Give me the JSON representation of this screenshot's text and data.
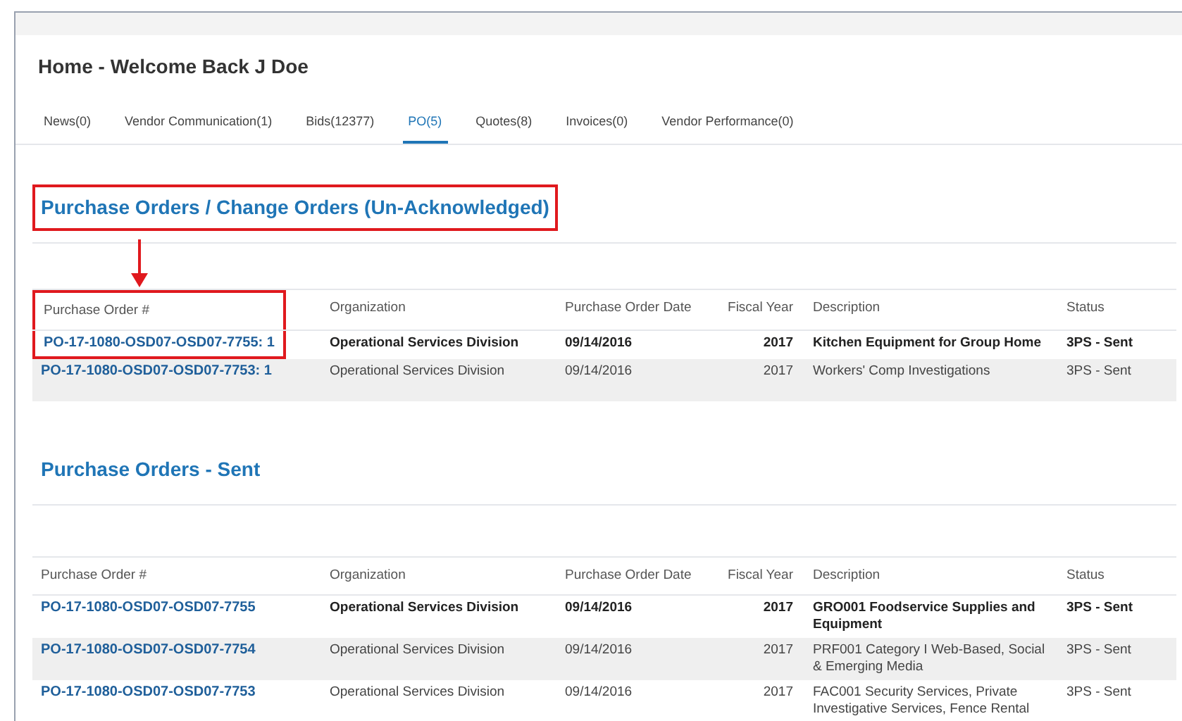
{
  "page_title": "Home - Welcome Back J Doe",
  "tabs": [
    {
      "label": "News(0)",
      "selected": false
    },
    {
      "label": "Vendor Communication(1)",
      "selected": false
    },
    {
      "label": "Bids(12377)",
      "selected": false
    },
    {
      "label": "PO(5)",
      "selected": true
    },
    {
      "label": "Quotes(8)",
      "selected": false
    },
    {
      "label": "Invoices(0)",
      "selected": false
    },
    {
      "label": "Vendor Performance(0)",
      "selected": false
    }
  ],
  "sections": [
    {
      "title": "Purchase Orders / Change Orders (Un-Acknowledged)",
      "callout": true,
      "columns": [
        "Purchase Order #",
        "Organization",
        "Purchase Order Date",
        "Fiscal Year",
        "Description",
        "Status"
      ],
      "rows": [
        {
          "bold": true,
          "cells": [
            "PO-17-1080-OSD07-OSD07-7755: 1",
            "Operational Services Division",
            "09/14/2016",
            "2017",
            "Kitchen Equipment for Group Home",
            "3PS - Sent"
          ]
        },
        {
          "bold": false,
          "cells": [
            "PO-17-1080-OSD07-OSD07-7753: 1",
            "Operational Services Division",
            "09/14/2016",
            "2017",
            "Workers' Comp Investigations",
            "3PS - Sent"
          ]
        }
      ]
    },
    {
      "title": "Purchase Orders - Sent",
      "callout": false,
      "columns": [
        "Purchase Order #",
        "Organization",
        "Purchase Order Date",
        "Fiscal Year",
        "Description",
        "Status"
      ],
      "rows": [
        {
          "bold": true,
          "cells": [
            "PO-17-1080-OSD07-OSD07-7755",
            "Operational Services Division",
            "09/14/2016",
            "2017",
            "GRO001 Foodservice Supplies and Equipment",
            "3PS - Sent"
          ]
        },
        {
          "bold": false,
          "cells": [
            "PO-17-1080-OSD07-OSD07-7754",
            "Operational Services Division",
            "09/14/2016",
            "2017",
            "PRF001 Category I Web-Based, Social & Emerging Media",
            "3PS - Sent"
          ]
        },
        {
          "bold": false,
          "cells": [
            "PO-17-1080-OSD07-OSD07-7753",
            "Operational Services Division",
            "09/14/2016",
            "2017",
            "FAC001 Security Services, Private Investigative Services, Fence Rental",
            "3PS - Sent"
          ]
        }
      ]
    }
  ]
}
